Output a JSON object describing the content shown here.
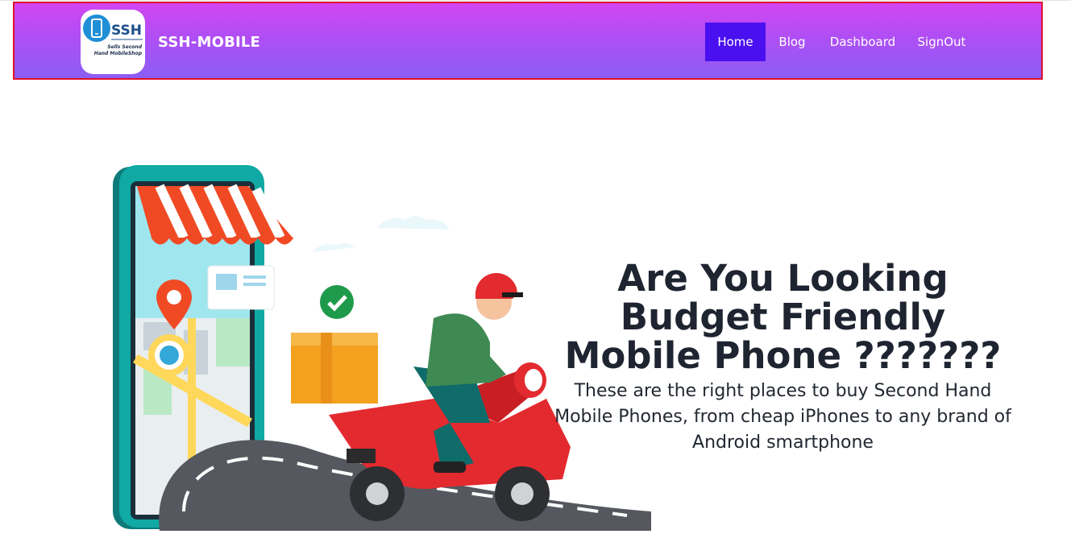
{
  "header": {
    "brand": "SSH-MOBILE",
    "logo": {
      "title": "SSH",
      "tagline_line1": "Sells Second",
      "tagline_line2": "Hand MobileShop",
      "icon": "smartphone-icon"
    },
    "nav": [
      {
        "label": "Home",
        "active": true
      },
      {
        "label": "Blog",
        "active": false
      },
      {
        "label": "Dashboard",
        "active": false
      },
      {
        "label": "SignOut",
        "active": false
      }
    ]
  },
  "hero": {
    "title": "Are You Looking Budget Friendly Mobile Phone ???????",
    "description": "These are the right places to buy Second Hand Mobile Phones, from cheap iPhones to any brand of Android smartphone",
    "illustration": "delivery-scooter-shop-phone-illustration"
  },
  "colors": {
    "navbar_top": "#d246f3",
    "navbar_bottom": "#8a5ef3",
    "navbar_border": "#e0102c",
    "active_nav": "#4a10f0",
    "text_dark": "#1e2430"
  }
}
